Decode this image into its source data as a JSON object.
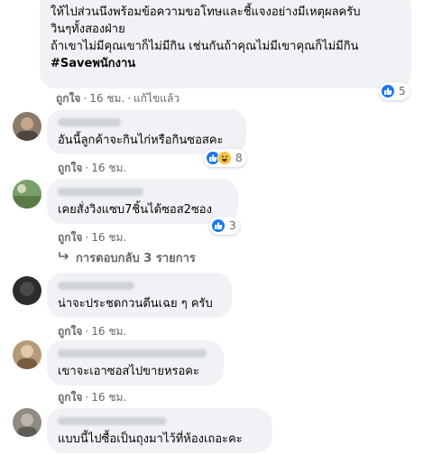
{
  "comments": [
    {
      "text_lines": [
        "ให้ไปส่วนนึงพร้อมข้อความขอโทษและชี้แจงอย่างมีเหตุผลครับ",
        "วินๆทั้งสองฝ่าย",
        "ถ้าเขาไม่มีคุณเขาก็ไม่มีกิน เช่นกันถ้าคุณไม่มีเขาคุณก็ไม่มีกิน"
      ],
      "hashtag": "#Saveพนักงาน",
      "like": "ถูกใจ",
      "time": "16 ชม.",
      "edited": "แก้ไขแล้ว",
      "reaction_count": "5",
      "reaction_types": [
        "like-icon"
      ]
    },
    {
      "text": "อันนี้ลูกค้าจะกินไก่หรือกินซอสคะ",
      "like": "ถูกใจ",
      "time": "16 ชม.",
      "reaction_count": "8",
      "reaction_types": [
        "like-icon",
        "haha-icon"
      ]
    },
    {
      "text": "เคยสั่งวิงแซบ7ชิ้นได้ซอส2ซอง",
      "like": "ถูกใจ",
      "time": "16 ชม.",
      "reaction_count": "3",
      "reaction_types": [
        "like-icon"
      ],
      "replies_label": "การตอบกลับ 3 รายการ"
    },
    {
      "text": "น่าจะประชดกวนตีนเฉย ๆ ครับ",
      "like": "ถูกใจ",
      "time": "16 ชม."
    },
    {
      "text": "เขาจะเอาซอสไปขายหรอคะ",
      "like": "ถูกใจ",
      "time": "16 ชม."
    },
    {
      "text": "แบบนี้ไปซื้อเป็นถุงมาไว้ที่ห้องเถอะคะ"
    }
  ],
  "colors": {
    "bubble": "#f0f2f5",
    "secondary_text": "#65676b",
    "like_blue": "#1877f2",
    "haha_yellow": "#f7c13f"
  }
}
